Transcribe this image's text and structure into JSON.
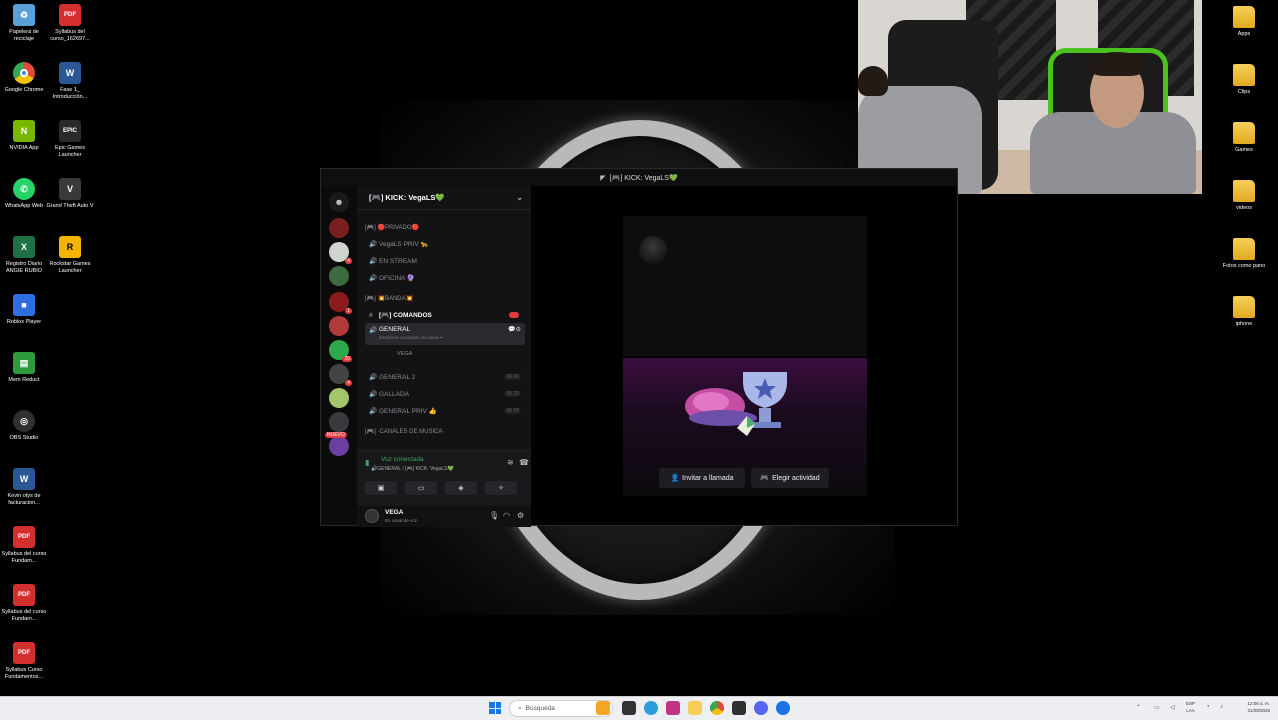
{
  "desktop_left": [
    {
      "label": "Papelera de reciclaje",
      "glyph": "♻",
      "color": "#5aa0d8"
    },
    {
      "label": "Syllabus del curso_162697...",
      "glyph": "PDF",
      "color": "#d32f2f"
    },
    {
      "label": "Google Chrome",
      "glyph": "●",
      "color": "#e24a3b"
    },
    {
      "label": "Fase 1_ Introducción...",
      "glyph": "W",
      "color": "#2b5797"
    },
    {
      "label": "NVIDIA App",
      "glyph": "N",
      "color": "#76b900"
    },
    {
      "label": "Epic Games Launcher",
      "glyph": "EPIC",
      "color": "#2a2a2a"
    },
    {
      "label": "WhatsApp Web",
      "glyph": "✆",
      "color": "#25d366"
    },
    {
      "label": "Grand Theft Auto V",
      "glyph": "V",
      "color": "#3a3a3a"
    },
    {
      "label": "Registro Diario ANGIE RUBIO",
      "glyph": "X",
      "color": "#1e7145"
    },
    {
      "label": "Rockstar Games Launcher",
      "glyph": "R",
      "color": "#f4b400"
    },
    {
      "label": "Roblox Player",
      "glyph": "■",
      "color": "#2d6ee3"
    },
    {
      "label": "Mem Reduct",
      "glyph": "▤",
      "color": "#2e9a3e"
    },
    {
      "label": "OBS Studio",
      "glyph": "◎",
      "color": "#303030"
    },
    {
      "label": "Kevin otys de facturacion...",
      "glyph": "W",
      "color": "#2b5797"
    },
    {
      "label": "Syllabus del curso Fundam...",
      "glyph": "PDF",
      "color": "#d32f2f"
    },
    {
      "label": "Syllabus del curso Fundam...",
      "glyph": "PDF",
      "color": "#d32f2f"
    },
    {
      "label": "Syllabus Curso Fundamentos...",
      "glyph": "PDF",
      "color": "#d32f2f"
    }
  ],
  "desktop_right": [
    {
      "label": "Apps"
    },
    {
      "label": "Clips"
    },
    {
      "label": "Games"
    },
    {
      "label": "videos"
    },
    {
      "label": "Fotos como pano"
    },
    {
      "label": "iphone"
    }
  ],
  "discord": {
    "window_title": "[🎮] KICK: VegaLS💚",
    "server_name": "[🎮] KICK: VegaLS💚",
    "guild_badges": [
      "4",
      "1",
      "20",
      "4",
      "NUEVO"
    ],
    "categories": [
      "[🎮] 🔴PRIVADO🔴",
      "[🎮] 💥BANDA💥",
      "[🎮] ·CANALES DE MUSICA·"
    ],
    "channels": [
      {
        "name": "VegaLS PRIV 🐆",
        "icon": "🔊"
      },
      {
        "name": "EN STREAM",
        "icon": "🔊"
      },
      {
        "name": "OFICINA 🔮",
        "icon": "🔊"
      },
      {
        "name": "[🎮] COMANDOS",
        "icon": "#"
      },
      {
        "name": "GENERAL",
        "icon": "🔊",
        "subtitle": "Establece un estado de canal ✏"
      },
      {
        "name": "GENERAL 2",
        "icon": "🔊",
        "count": "00 20"
      },
      {
        "name": "GALLADA",
        "icon": "🔊",
        "count": "00 20"
      },
      {
        "name": "GENERAL PRIV 👍",
        "icon": "🔊",
        "count": "00 10"
      }
    ],
    "voice_member": "VEGA",
    "voice_status": "Voz conectada",
    "voice_location": "🔊GENERAL / [🎮] KICK: VegaLS💚",
    "user_name": "VEGA",
    "user_status": "En canal de voz",
    "invite_label": "Invitar a llamada",
    "activity_label": "Elegir actividad"
  },
  "taskbar": {
    "search_placeholder": "Búsqueda",
    "lang_top": "ESP",
    "lang_bottom": "LAA",
    "time": "12:06 a. m.",
    "date": "31/08/2025"
  },
  "colors": {
    "discord_green": "#3ba55c",
    "discord_red": "#e23b3b",
    "folder_yellow": "#f6cf5b",
    "accent_blue": "#1677e6"
  }
}
